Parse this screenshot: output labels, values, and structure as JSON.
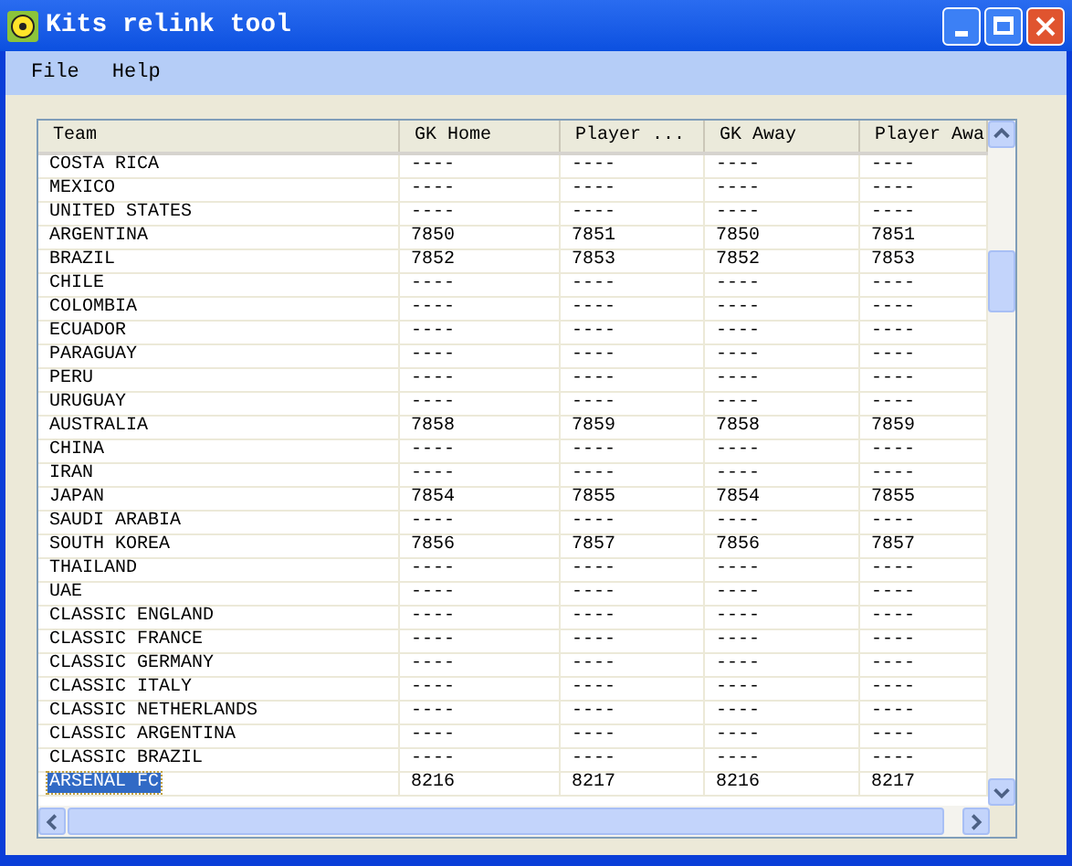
{
  "window": {
    "title": "Kits relink tool"
  },
  "menu": [
    "File",
    "Help"
  ],
  "table": {
    "columns": [
      "Team",
      "GK Home",
      "Player ...",
      "GK Away",
      "Player Awa"
    ],
    "rows": [
      {
        "cells": [
          "COSTA RICA",
          "----",
          "----",
          "----",
          "----"
        ],
        "selected": false
      },
      {
        "cells": [
          "MEXICO",
          "----",
          "----",
          "----",
          "----"
        ],
        "selected": false
      },
      {
        "cells": [
          "UNITED STATES",
          "----",
          "----",
          "----",
          "----"
        ],
        "selected": false
      },
      {
        "cells": [
          "ARGENTINA",
          "7850",
          "7851",
          "7850",
          "7851"
        ],
        "selected": false
      },
      {
        "cells": [
          "BRAZIL",
          "7852",
          "7853",
          "7852",
          "7853"
        ],
        "selected": false
      },
      {
        "cells": [
          "CHILE",
          "----",
          "----",
          "----",
          "----"
        ],
        "selected": false
      },
      {
        "cells": [
          "COLOMBIA",
          "----",
          "----",
          "----",
          "----"
        ],
        "selected": false
      },
      {
        "cells": [
          "ECUADOR",
          "----",
          "----",
          "----",
          "----"
        ],
        "selected": false
      },
      {
        "cells": [
          "PARAGUAY",
          "----",
          "----",
          "----",
          "----"
        ],
        "selected": false
      },
      {
        "cells": [
          "PERU",
          "----",
          "----",
          "----",
          "----"
        ],
        "selected": false
      },
      {
        "cells": [
          "URUGUAY",
          "----",
          "----",
          "----",
          "----"
        ],
        "selected": false
      },
      {
        "cells": [
          "AUSTRALIA",
          "7858",
          "7859",
          "7858",
          "7859"
        ],
        "selected": false
      },
      {
        "cells": [
          "CHINA",
          "----",
          "----",
          "----",
          "----"
        ],
        "selected": false
      },
      {
        "cells": [
          "IRAN",
          "----",
          "----",
          "----",
          "----"
        ],
        "selected": false
      },
      {
        "cells": [
          "JAPAN",
          "7854",
          "7855",
          "7854",
          "7855"
        ],
        "selected": false
      },
      {
        "cells": [
          "SAUDI ARABIA",
          "----",
          "----",
          "----",
          "----"
        ],
        "selected": false
      },
      {
        "cells": [
          "SOUTH KOREA",
          "7856",
          "7857",
          "7856",
          "7857"
        ],
        "selected": false
      },
      {
        "cells": [
          "THAILAND",
          "----",
          "----",
          "----",
          "----"
        ],
        "selected": false
      },
      {
        "cells": [
          "UAE",
          "----",
          "----",
          "----",
          "----"
        ],
        "selected": false
      },
      {
        "cells": [
          "CLASSIC ENGLAND",
          "----",
          "----",
          "----",
          "----"
        ],
        "selected": false
      },
      {
        "cells": [
          "CLASSIC FRANCE",
          "----",
          "----",
          "----",
          "----"
        ],
        "selected": false
      },
      {
        "cells": [
          "CLASSIC GERMANY",
          "----",
          "----",
          "----",
          "----"
        ],
        "selected": false
      },
      {
        "cells": [
          "CLASSIC ITALY",
          "----",
          "----",
          "----",
          "----"
        ],
        "selected": false
      },
      {
        "cells": [
          "CLASSIC NETHERLANDS",
          "----",
          "----",
          "----",
          "----"
        ],
        "selected": false
      },
      {
        "cells": [
          "CLASSIC ARGENTINA",
          "----",
          "----",
          "----",
          "----"
        ],
        "selected": false
      },
      {
        "cells": [
          "CLASSIC BRAZIL",
          "----",
          "----",
          "----",
          "----"
        ],
        "selected": false
      },
      {
        "cells": [
          "ARSENAL FC",
          "8216",
          "8217",
          "8216",
          "8217"
        ],
        "selected": true
      }
    ]
  }
}
